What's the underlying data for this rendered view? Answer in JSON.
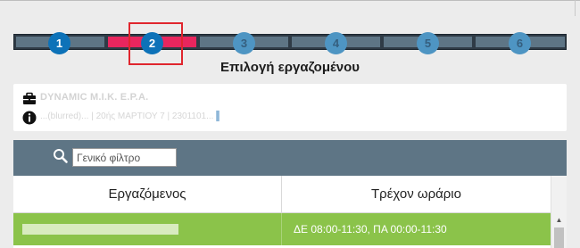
{
  "wizard": {
    "steps": [
      {
        "number": "1",
        "state": "done"
      },
      {
        "number": "2",
        "state": "current"
      },
      {
        "number": "3",
        "state": "todo"
      },
      {
        "number": "4",
        "state": "todo"
      },
      {
        "number": "5",
        "state": "todo"
      },
      {
        "number": "6",
        "state": "todo"
      }
    ],
    "title": "Επιλογή εργαζομένου"
  },
  "company": {
    "name": "DYNAMIC M.I.K. E.P.A.",
    "details": "...(blurred)... | 20ής ΜΑΡΤΙΟΥ 7 | 2301101...",
    "icons": [
      "briefcase-icon",
      "info-icon"
    ]
  },
  "filter": {
    "placeholder": "Γενικό φίλτρο",
    "icon": "search-icon"
  },
  "table": {
    "columns": [
      "Εργαζόμενος",
      "Τρέχον ωράριο"
    ],
    "rows": [
      {
        "employee": "",
        "schedule": "ΔΕ 08:00-11:30, ΠΑ 00:00-11:30"
      }
    ]
  },
  "colors": {
    "active_step": "#e8265e",
    "step_dot": "#0d72b8",
    "bar": "#5e7585",
    "selected_row": "#8bc34a"
  }
}
